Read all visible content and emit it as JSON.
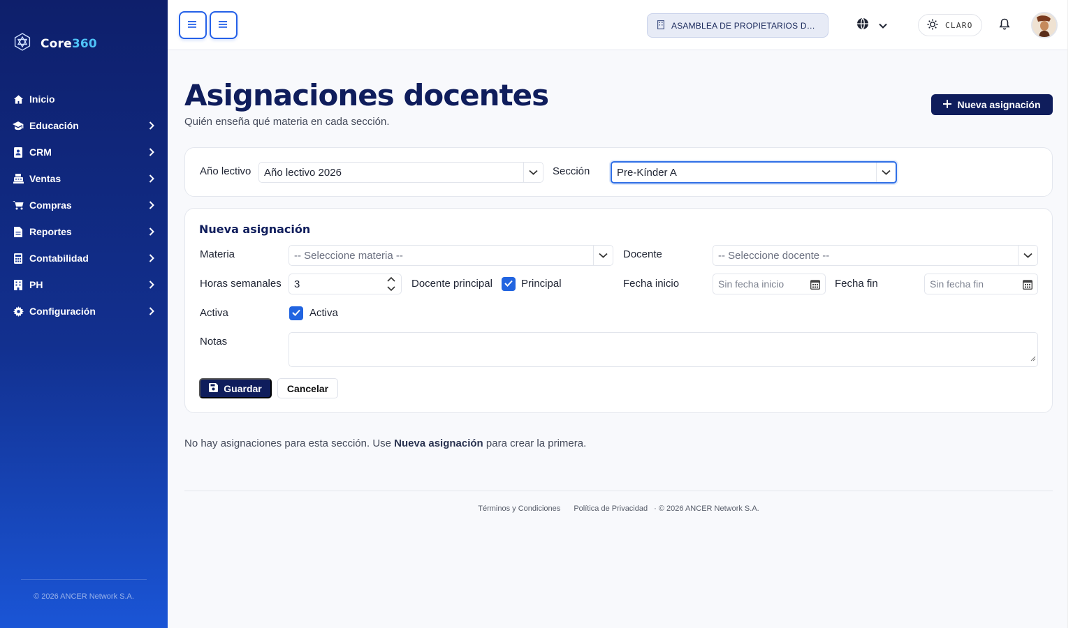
{
  "brand": {
    "name_prefix": "Core",
    "name_suffix": "360"
  },
  "sidebar": {
    "items": [
      {
        "label": "Inicio",
        "icon": "home-icon",
        "has_children": false
      },
      {
        "label": "Educación",
        "icon": "graduation-cap-icon",
        "has_children": true
      },
      {
        "label": "CRM",
        "icon": "contact-book-icon",
        "has_children": true
      },
      {
        "label": "Ventas",
        "icon": "cash-register-icon",
        "has_children": true
      },
      {
        "label": "Compras",
        "icon": "cart-icon",
        "has_children": true
      },
      {
        "label": "Reportes",
        "icon": "file-icon",
        "has_children": true
      },
      {
        "label": "Contabilidad",
        "icon": "calculator-icon",
        "has_children": true
      },
      {
        "label": "PH",
        "icon": "building-icon",
        "has_children": true
      },
      {
        "label": "Configuración",
        "icon": "gear-icon",
        "has_children": true
      }
    ],
    "footer": "© 2026 ANCER Network S.A."
  },
  "topbar": {
    "organization": "ASAMBLEA DE PROPIETARIOS DE PH DIAMOND HILL",
    "theme_label": "CLARO"
  },
  "page": {
    "title": "Asignaciones docentes",
    "subtitle": "Quién enseña qué materia en cada sección.",
    "new_button": "Nueva asignación"
  },
  "filters": {
    "year_label": "Año lectivo",
    "year_value": "Año lectivo 2026",
    "section_label": "Sección",
    "section_value": "Pre-Kínder A"
  },
  "form": {
    "title": "Nueva asignación",
    "materia_label": "Materia",
    "materia_placeholder": "-- Seleccione materia --",
    "docente_label": "Docente",
    "docente_placeholder": "-- Seleccione docente --",
    "horas_label": "Horas semanales",
    "horas_value": "3",
    "principal_label": "Docente principal",
    "principal_check_label": "Principal",
    "principal_checked": true,
    "fecha_inicio_label": "Fecha inicio",
    "fecha_inicio_placeholder": "Sin fecha inicio",
    "fecha_fin_label": "Fecha fin",
    "fecha_fin_placeholder": "Sin fecha fin",
    "activa_label": "Activa",
    "activa_check_label": "Activa",
    "activa_checked": true,
    "notas_label": "Notas",
    "save_button": "Guardar",
    "cancel_button": "Cancelar"
  },
  "empty_state": {
    "prefix": "No hay asignaciones para esta sección. Use ",
    "emphasis": "Nueva asignación",
    "suffix": " para crear la primera."
  },
  "footer": {
    "terms": "Términos y Condiciones",
    "privacy": "Política de Privacidad",
    "copyright": "· © 2026 ANCER Network S.A."
  },
  "colors": {
    "primary": "#0f1d5c",
    "accent": "#2460e8",
    "checkbox": "#2164e0",
    "sidebar_top": "#0e1f6b",
    "sidebar_bottom": "#1a55d6",
    "brand_accent": "#4fc3f7"
  }
}
